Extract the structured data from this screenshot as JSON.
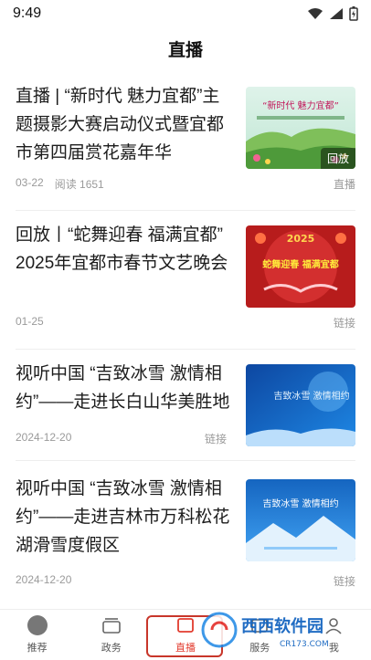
{
  "status_bar": {
    "time": "9:49"
  },
  "header": {
    "title": "直播"
  },
  "feed": [
    {
      "headline": "直播 | “新时代 魅力宜都”主题摄影大赛启动仪式暨宜都市第四届赏花嘉年华",
      "date": "03-22",
      "reads": "阅读 1651",
      "tag": "直播",
      "thumb_badge": "回放",
      "thumb_text": "“新时代 魅力宜都”"
    },
    {
      "headline": "回放丨“蛇舞迎春 福满宜都” 2025年宜都市春节文艺晚会",
      "date": "01-25",
      "tag": "链接",
      "thumb_text": "蛇舞迎春 福满宜都",
      "thumb_year": "2025"
    },
    {
      "headline": "视听中国 “吉致冰雪 激情相约”——走进长白山华美胜地",
      "date": "2024-12-20",
      "tag": "链接",
      "thumb_text": "吉致冰雪 激情相约"
    },
    {
      "headline": "视听中国 “吉致冰雪 激情相约”——走进吉林市万科松花湖滑雪度假区",
      "date": "2024-12-20",
      "tag": "链接",
      "thumb_text": "吉致冰雪 激情相约"
    }
  ],
  "tabbar": {
    "items": [
      {
        "label": "推荐",
        "icon": "home-circle-icon"
      },
      {
        "label": "政务",
        "icon": "stack-icon"
      },
      {
        "label": "直播",
        "icon": "live-icon",
        "active": true
      },
      {
        "label": "服务",
        "icon": "service-icon"
      },
      {
        "label": "我",
        "icon": "user-icon"
      }
    ]
  },
  "watermark": {
    "text": "西西软件园",
    "sub": "CR173.COM"
  },
  "colors": {
    "accent": "#e23b2e",
    "muted": "#9a9a9a",
    "divider": "#eeeeee"
  }
}
